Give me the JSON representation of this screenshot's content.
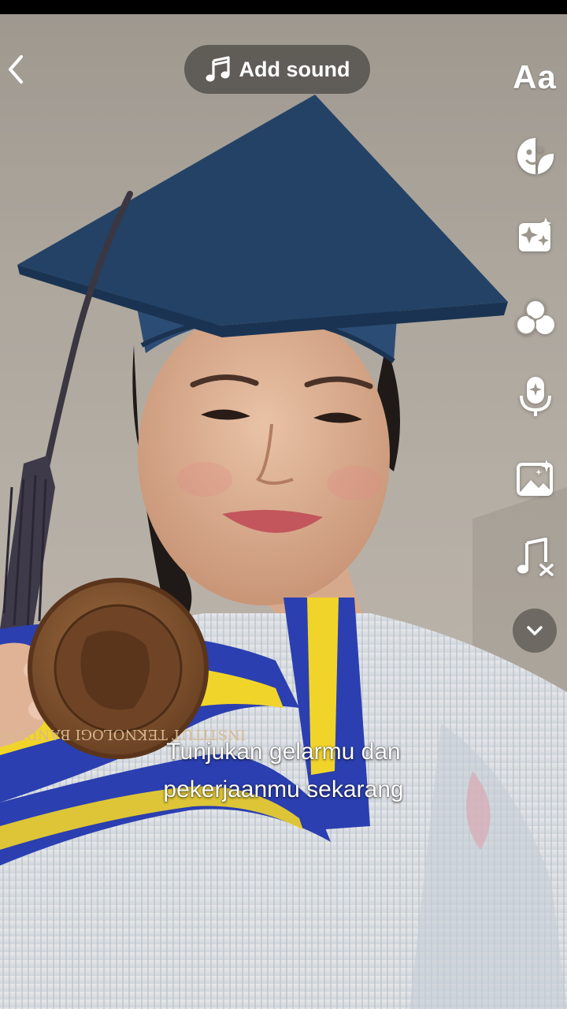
{
  "top_bar": {
    "back_icon": "chevron-left-icon",
    "add_sound": {
      "label": "Add sound",
      "icon": "music-note-icon"
    }
  },
  "right_toolbar": {
    "items": [
      {
        "id": "text",
        "label": "Aa",
        "icon": "text-icon"
      },
      {
        "id": "stickers",
        "icon": "sticker-icon"
      },
      {
        "id": "effects",
        "icon": "effects-icon"
      },
      {
        "id": "filters",
        "icon": "filters-icon"
      },
      {
        "id": "voice",
        "icon": "voice-effects-icon"
      },
      {
        "id": "image",
        "icon": "image-sparkle-icon"
      },
      {
        "id": "remove-sound",
        "icon": "music-off-icon"
      },
      {
        "id": "more",
        "icon": "chevron-down-icon"
      }
    ]
  },
  "caption": {
    "line1": "Tunjukan gelarmu dan",
    "line2": "pekerjaanmu sekarang"
  },
  "scene": {
    "subject": "person in graduation cap holding a medal",
    "medal_text": "INSTITUT TEKNOLOGI BANDUNG"
  },
  "colors": {
    "overlay_pill": "#46443f",
    "icon": "#ffffff",
    "cap_blue": "#27456a",
    "sash_blue": "#2b3fb0",
    "sash_yellow": "#f1d42a",
    "medal_bronze": "#8a5a33"
  }
}
